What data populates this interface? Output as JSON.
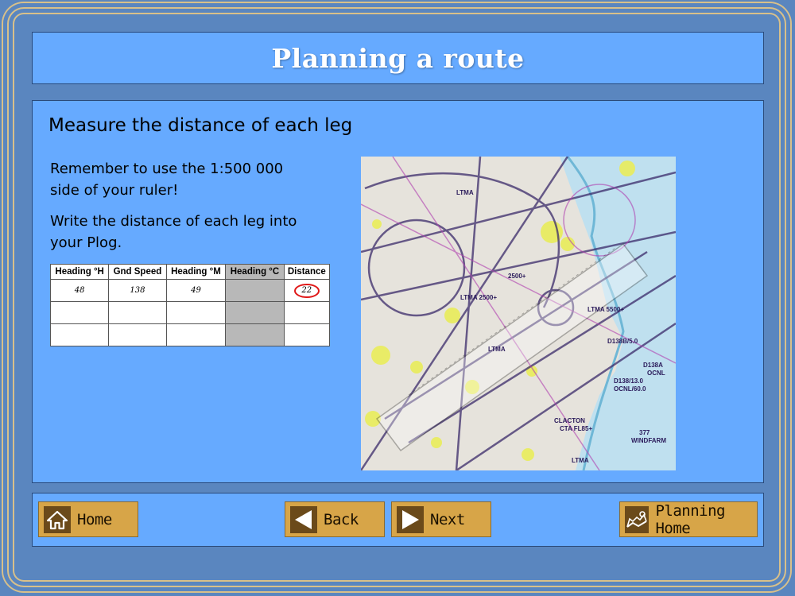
{
  "title": "Planning a route",
  "content": {
    "heading": "Measure the distance of each leg",
    "paragraph1": "Remember to use the 1:500 000 side of your ruler!",
    "paragraph2": "Write the distance of each leg into your Plog."
  },
  "plog": {
    "headers": [
      "Heading °H",
      "Gnd Speed",
      "Heading °M",
      "Heading °C",
      "Distance"
    ],
    "rows": [
      [
        "48",
        "138",
        "49",
        "",
        "22"
      ],
      [
        "",
        "",
        "",
        "",
        ""
      ],
      [
        "",
        "",
        "",
        "",
        ""
      ]
    ]
  },
  "map": {
    "labels": [
      "LTMA",
      "LTMA",
      "LTMA",
      "LTMA",
      "CLACTON",
      "CTA FL85+",
      "LTMA 5500+",
      "LTMA 2500+",
      "2500+",
      "D138B/5.0",
      "D138/13.0 OCNL/60.0",
      "D138A OCNL",
      "WINDFARM",
      "377"
    ]
  },
  "nav": {
    "home": "Home",
    "back": "Back",
    "next": "Next",
    "planning_home": "Planning Home"
  },
  "colors": {
    "background": "#5a86bf",
    "panel": "#66aaff",
    "button": "#d7a548",
    "button_icon_bg": "#6b4a1a",
    "frame_gold": "#d8c08a",
    "highlight_circle": "#e01818"
  },
  "icons": {
    "home": "home-icon",
    "back": "triangle-left-icon",
    "next": "triangle-right-icon",
    "planning_home": "map-icon"
  }
}
